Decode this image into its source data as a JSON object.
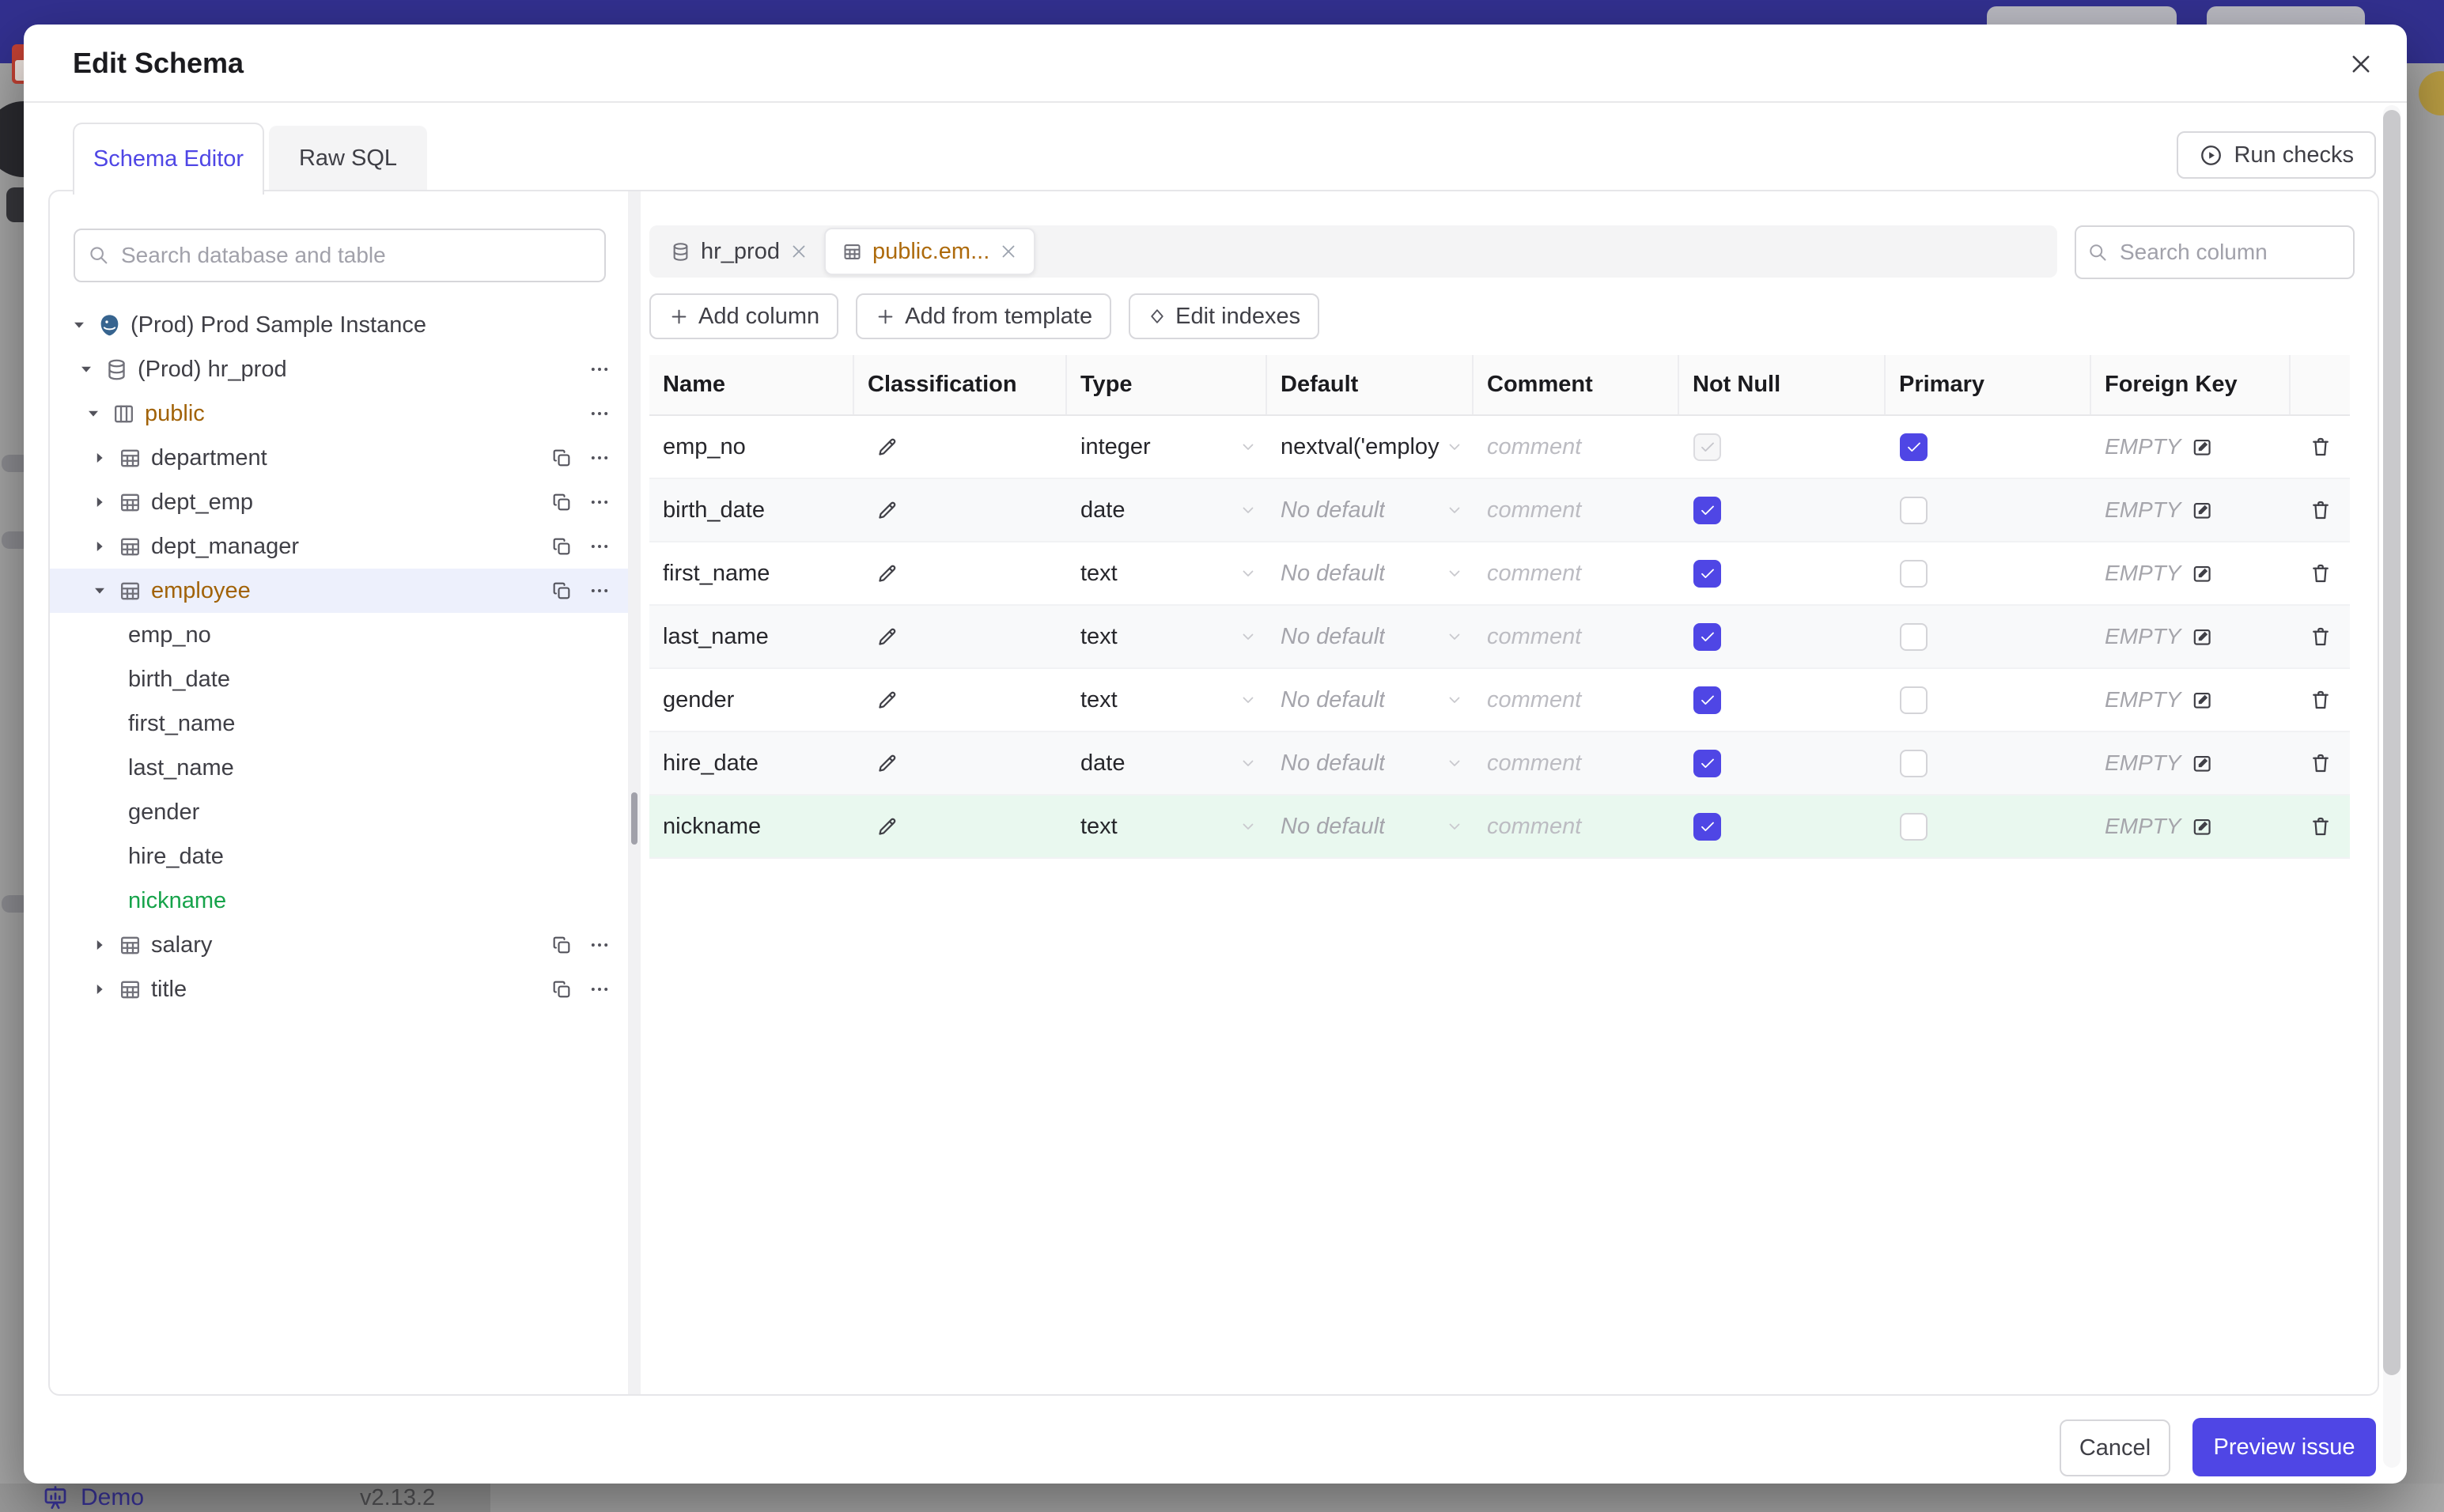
{
  "modal": {
    "title": "Edit Schema",
    "tabs": [
      {
        "label": "Schema Editor"
      },
      {
        "label": "Raw SQL"
      }
    ],
    "run_checks_label": "Run checks"
  },
  "sidebar": {
    "search_placeholder": "Search database and table",
    "tree": [
      {
        "label": "(Prod) Prod Sample Instance",
        "icon": "postgres-icon",
        "expanded": true
      },
      {
        "label": "(Prod) hr_prod",
        "icon": "database-icon",
        "expanded": true
      },
      {
        "label": "public",
        "icon": "schema-icon",
        "expanded": true,
        "color": "amber"
      },
      {
        "label": "department",
        "icon": "table-icon"
      },
      {
        "label": "dept_emp",
        "icon": "table-icon"
      },
      {
        "label": "dept_manager",
        "icon": "table-icon"
      },
      {
        "label": "employee",
        "icon": "table-icon",
        "expanded": true,
        "selected": true,
        "color": "amber"
      },
      {
        "label": "emp_no",
        "kind": "column"
      },
      {
        "label": "birth_date",
        "kind": "column"
      },
      {
        "label": "first_name",
        "kind": "column"
      },
      {
        "label": "last_name",
        "kind": "column"
      },
      {
        "label": "gender",
        "kind": "column"
      },
      {
        "label": "hire_date",
        "kind": "column"
      },
      {
        "label": "nickname",
        "kind": "column",
        "color": "green"
      },
      {
        "label": "salary",
        "icon": "table-icon"
      },
      {
        "label": "title",
        "icon": "table-icon"
      }
    ]
  },
  "editor": {
    "chips": [
      {
        "label": "hr_prod",
        "icon": "database-icon",
        "active": false
      },
      {
        "label": "public.em...",
        "icon": "table-icon",
        "active": true
      }
    ],
    "column_search_placeholder": "Search column",
    "toolbar": {
      "add_column": "Add column",
      "add_from_template": "Add from template",
      "edit_indexes": "Edit indexes"
    },
    "table": {
      "headers": [
        "Name",
        "Classification",
        "Type",
        "Default",
        "Comment",
        "Not Null",
        "Primary",
        "Foreign Key"
      ],
      "comment_placeholder": "comment",
      "fk_empty": "EMPTY",
      "rows": [
        {
          "name": "emp_no",
          "type": "integer",
          "default": "nextval('employ",
          "default_placeholder": false,
          "not_null": "disabled-checked",
          "primary": "checked",
          "fk": "EMPTY",
          "highlight": false
        },
        {
          "name": "birth_date",
          "type": "date",
          "default": "No default",
          "default_placeholder": true,
          "not_null": "checked",
          "primary": "unchecked",
          "fk": "EMPTY",
          "highlight": false
        },
        {
          "name": "first_name",
          "type": "text",
          "default": "No default",
          "default_placeholder": true,
          "not_null": "checked",
          "primary": "unchecked",
          "fk": "EMPTY",
          "highlight": false
        },
        {
          "name": "last_name",
          "type": "text",
          "default": "No default",
          "default_placeholder": true,
          "not_null": "checked",
          "primary": "unchecked",
          "fk": "EMPTY",
          "highlight": false
        },
        {
          "name": "gender",
          "type": "text",
          "default": "No default",
          "default_placeholder": true,
          "not_null": "checked",
          "primary": "unchecked",
          "fk": "EMPTY",
          "highlight": false
        },
        {
          "name": "hire_date",
          "type": "date",
          "default": "No default",
          "default_placeholder": true,
          "not_null": "checked",
          "primary": "unchecked",
          "fk": "EMPTY",
          "highlight": false
        },
        {
          "name": "nickname",
          "type": "text",
          "default": "No default",
          "default_placeholder": true,
          "not_null": "checked",
          "primary": "unchecked",
          "fk": "EMPTY",
          "highlight": true
        }
      ]
    }
  },
  "footer": {
    "cancel": "Cancel",
    "preview": "Preview issue"
  },
  "statusbar": {
    "brand": "Demo",
    "version": "v2.13.2"
  },
  "colors": {
    "accent": "#4f46e5",
    "schema_amber": "#a16207",
    "column_green": "#16a34a",
    "selected_tree_row": "#edf0fc",
    "new_column_row": "#e9f8ef",
    "banner": "#32308f",
    "backdrop": "#a6a6a6"
  }
}
